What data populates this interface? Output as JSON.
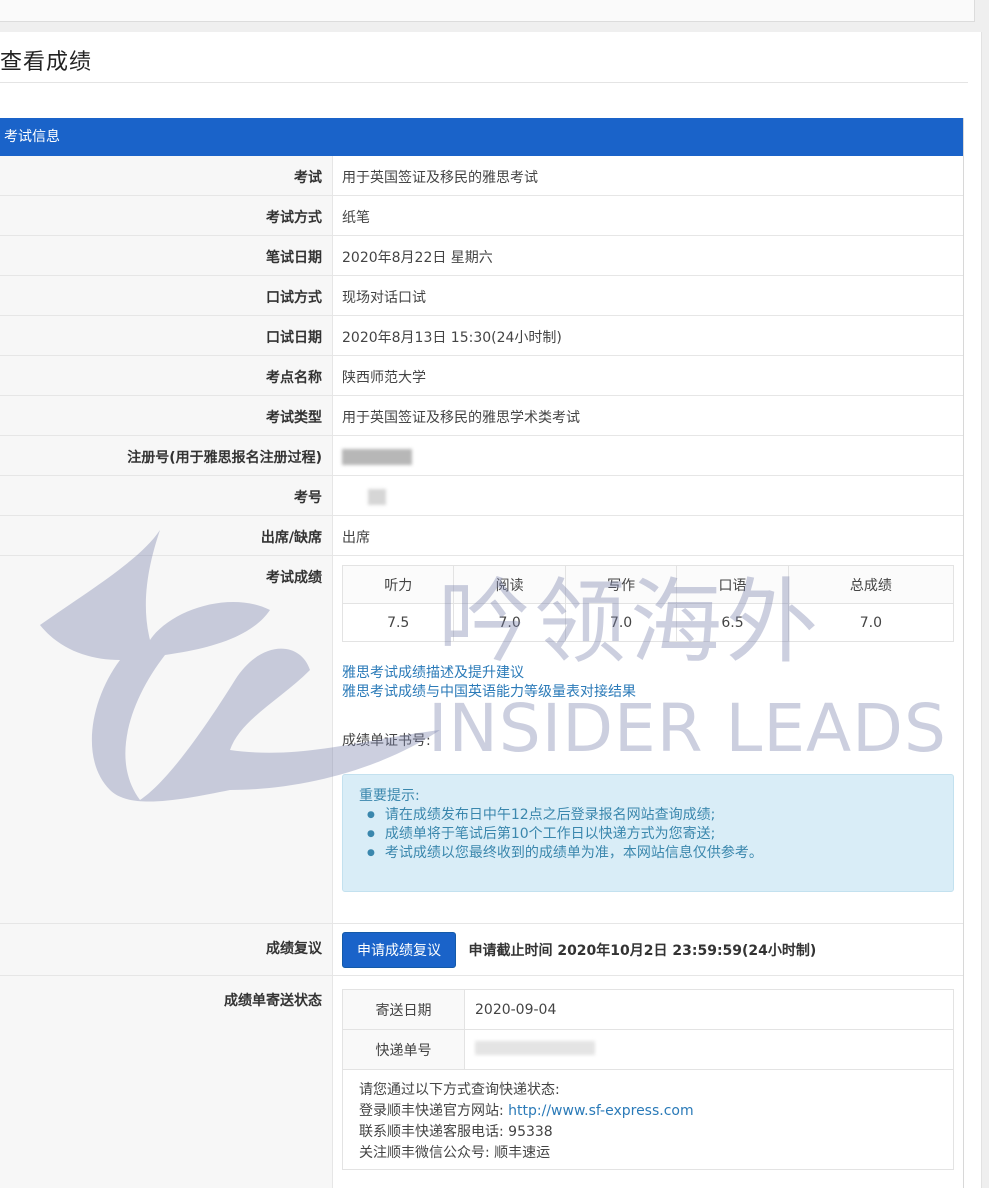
{
  "page": {
    "title": "查看成绩"
  },
  "card": {
    "header": "考试信息"
  },
  "rows": [
    {
      "label": "考试",
      "value": "用于英国签证及移民的雅思考试"
    },
    {
      "label": "考试方式",
      "value": "纸笔"
    },
    {
      "label": "笔试日期",
      "value": "2020年8月22日 星期六"
    },
    {
      "label": "口试方式",
      "value": "现场对话口试"
    },
    {
      "label": "口试日期",
      "value": "2020年8月13日 15:30(24小时制)"
    },
    {
      "label": "考点名称",
      "value": "陕西师范大学"
    },
    {
      "label": "考试类型",
      "value": "用于英国签证及移民的雅思学术类考试"
    },
    {
      "label": "注册号(用于雅思报名注册过程)",
      "value": ""
    },
    {
      "label": "考号",
      "value": ""
    },
    {
      "label": "出席/缺席",
      "value": "出席"
    }
  ],
  "scores": {
    "label": "考试成绩",
    "headers": [
      "听力",
      "阅读",
      "写作",
      "口语",
      "总成绩"
    ],
    "values": [
      "7.5",
      "7.0",
      "7.0",
      "6.5",
      "7.0"
    ],
    "link1": "雅思考试成绩描述及提升建议",
    "link2": "雅思考试成绩与中国英语能力等级量表对接结果",
    "cert_label": "成绩单证书号:"
  },
  "notice": {
    "title": "重要提示:",
    "items": [
      "请在成绩发布日中午12点之后登录报名网站查询成绩;",
      "成绩单将于笔试后第10个工作日以快递方式为您寄送;",
      "考试成绩以您最终收到的成绩单为准，本网站信息仅供参考。"
    ]
  },
  "review": {
    "label": "成绩复议",
    "button": "申请成绩复议",
    "deadline": "申请截止时间 2020年10月2日 23:59:59(24小时制)"
  },
  "shipping": {
    "label": "成绩单寄送状态",
    "date_label": "寄送日期",
    "date_value": "2020-09-04",
    "tracking_label": "快递单号",
    "tracking_value": "",
    "info_title": "请您通过以下方式查询快递状态:",
    "line1_prefix": "登录顺丰快递官方网站:",
    "line1_link": "http://www.sf-express.com",
    "line2": "联系顺丰快递客服电话: 95338",
    "line3": "关注顺丰微信公众号: 顺丰速运"
  },
  "watermark": {
    "cn": "吟领海外",
    "en": "INSIDER LEADS"
  },
  "colors": {
    "primary": "#1a63c9",
    "link": "#2a7ab8",
    "notice_bg": "#d9edf7"
  }
}
